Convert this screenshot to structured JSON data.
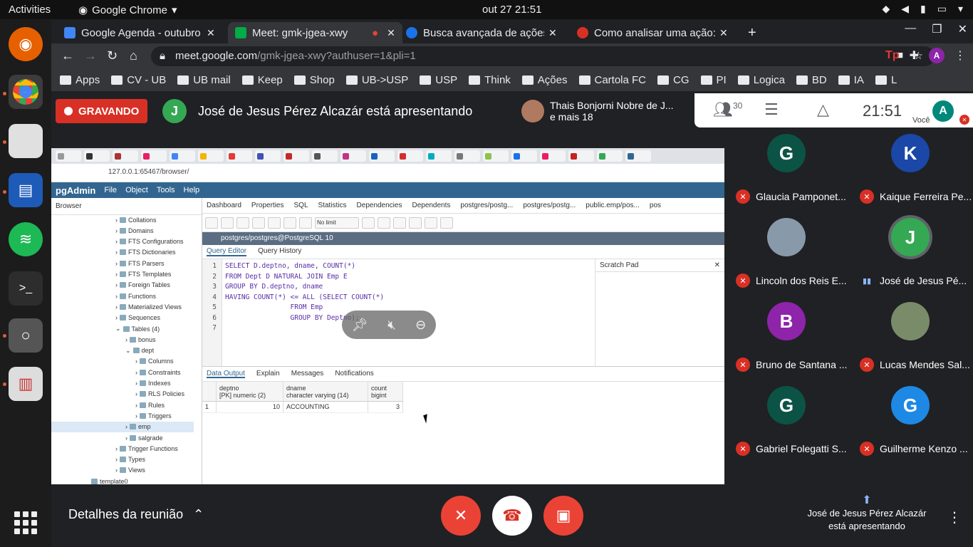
{
  "system": {
    "activities": "Activities",
    "app": "Google Chrome",
    "clock": "out 27  21:51"
  },
  "tabs": [
    {
      "title": "Google Agenda - outubro",
      "color": "#4285f4"
    },
    {
      "title": "Meet: gmk-jgea-xwy",
      "color": "#00ac47"
    },
    {
      "title": "Busca avançada de ações",
      "color": "#1a73e8"
    },
    {
      "title": "Como analisar uma ação:",
      "color": "#d93025"
    }
  ],
  "address": {
    "host": "meet.google.com",
    "path": "/gmk-jgea-xwy?authuser=1&pli=1"
  },
  "bookmarks": [
    "Apps",
    "CV - UB",
    "UB mail",
    "Keep",
    "Shop",
    "UB->USP",
    "USP",
    "Think",
    "Ações",
    "Cartola FC",
    "CG",
    "PI",
    "Logica",
    "BD",
    "IA",
    "L"
  ],
  "meet": {
    "recording_label": "GRAVANDO",
    "presenter_text": "José de Jesus Pérez Alcazár está apresentando",
    "presenter_initial": "J",
    "others_line1": "Thais Bonjorni Nobre de J...",
    "others_line2": "e mais 18",
    "participant_count": "30",
    "time": "21:51",
    "you_label": "Você",
    "you_initial": "A",
    "details_label": "Detalhes da reunião",
    "presenting_footer": "José de Jesus Pérez Alcazár está apresentando"
  },
  "pgadmin": {
    "url": "127.0.0.1:65467/browser/",
    "logo": "pgAdmin",
    "menu": [
      "File",
      "Object",
      "Tools",
      "Help"
    ],
    "browser_label": "Browser",
    "object_tabs": [
      "Dashboard",
      "Properties",
      "SQL",
      "Statistics",
      "Dependencies",
      "Dependents",
      "postgres/postg...",
      "postgres/postg...",
      "public.emp/pos...",
      "pos"
    ],
    "no_limit": "No limit",
    "connection": "postgres/postgres@PostgreSQL 10",
    "editor_tabs": [
      "Query Editor",
      "Query History"
    ],
    "scratch_pad": "Scratch Pad",
    "sql_lines": [
      "SELECT D.deptno, dname, COUNT(*)",
      "FROM Dept D NATURAL JOIN Emp E",
      "GROUP BY D.deptno, dname",
      "HAVING COUNT(*) <= ALL (SELECT COUNT(*)",
      "                FROM Emp",
      "                GROUP BY Deptno);",
      ""
    ],
    "line_numbers": [
      "1",
      "2",
      "3",
      "4",
      "5",
      "6",
      "7"
    ],
    "output_tabs": [
      "Data Output",
      "Explain",
      "Messages",
      "Notifications"
    ],
    "columns": [
      {
        "name": "deptno",
        "type": "[PK] numeric (2)"
      },
      {
        "name": "dname",
        "type": "character varying (14)"
      },
      {
        "name": "count",
        "type": "bigint"
      }
    ],
    "rows": [
      {
        "n": "1",
        "deptno": "10",
        "dname": "ACCOUNTING",
        "count": "3"
      }
    ],
    "tree": [
      {
        "label": "Collations",
        "indent": 1
      },
      {
        "label": "Domains",
        "indent": 1
      },
      {
        "label": "FTS Configurations",
        "indent": 1
      },
      {
        "label": "FTS Dictionaries",
        "indent": 1
      },
      {
        "label": "FTS Parsers",
        "indent": 1
      },
      {
        "label": "FTS Templates",
        "indent": 1
      },
      {
        "label": "Foreign Tables",
        "indent": 1
      },
      {
        "label": "Functions",
        "indent": 1
      },
      {
        "label": "Materialized Views",
        "indent": 1
      },
      {
        "label": "Sequences",
        "indent": 1
      },
      {
        "label": "Tables (4)",
        "indent": 1
      },
      {
        "label": "bonus",
        "indent": 2
      },
      {
        "label": "dept",
        "indent": 2
      },
      {
        "label": "Columns",
        "indent": 3
      },
      {
        "label": "Constraints",
        "indent": 3
      },
      {
        "label": "Indexes",
        "indent": 3
      },
      {
        "label": "RLS Policies",
        "indent": 3
      },
      {
        "label": "Rules",
        "indent": 3
      },
      {
        "label": "Triggers",
        "indent": 3
      },
      {
        "label": "emp",
        "indent": 2
      },
      {
        "label": "salgrade",
        "indent": 2
      },
      {
        "label": "Trigger Functions",
        "indent": 1
      },
      {
        "label": "Types",
        "indent": 1
      },
      {
        "label": "Views",
        "indent": 1
      },
      {
        "label": "template0",
        "indent": 0
      }
    ]
  },
  "participants": [
    {
      "initial": "G",
      "name": "Glaucia Pamponet...",
      "color": "#0b5345"
    },
    {
      "initial": "K",
      "name": "Kaique Ferreira Pe...",
      "color": "#1a47a8"
    },
    {
      "initial": "",
      "name": "Lincoln dos Reis E...",
      "color": "#8899aa"
    },
    {
      "initial": "J",
      "name": "José de Jesus Pé...",
      "color": "#34a853"
    },
    {
      "initial": "B",
      "name": "Bruno de Santana ...",
      "color": "#8e24aa"
    },
    {
      "initial": "",
      "name": "Lucas Mendes Sal...",
      "color": "#7a8b6a"
    },
    {
      "initial": "G",
      "name": "Gabriel Folegatti S...",
      "color": "#0b5345"
    },
    {
      "initial": "G",
      "name": "Guilherme Kenzo ...",
      "color": "#1e88e5"
    }
  ]
}
